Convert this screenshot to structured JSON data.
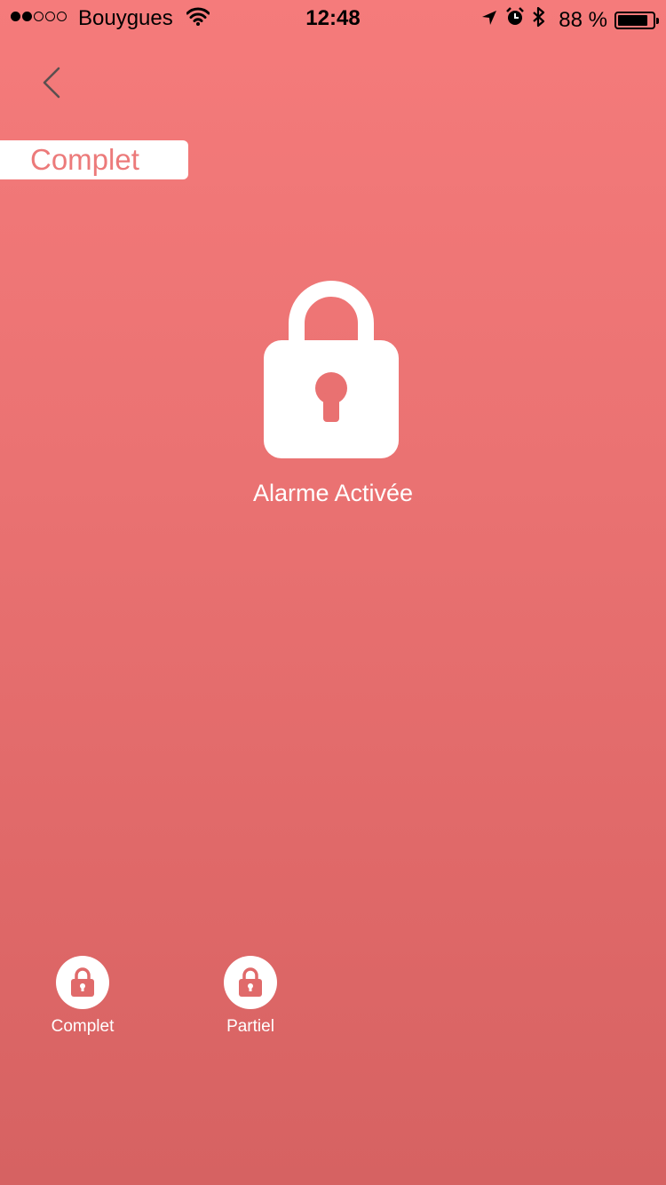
{
  "status_bar": {
    "carrier": "Bouygues",
    "signal_bars_filled": 2,
    "signal_bars_total": 5,
    "time": "12:48",
    "battery_text": "88 %",
    "battery_level": 0.88,
    "icons": [
      "wifi-icon",
      "location-arrow-icon",
      "alarm-clock-icon",
      "bluetooth-icon",
      "battery-icon"
    ]
  },
  "nav": {
    "back_icon": "chevron-left-icon"
  },
  "mode_tag": {
    "label": "Complet"
  },
  "alarm": {
    "icon": "padlock-locked-icon",
    "status_text": "Alarme Activée"
  },
  "modes": [
    {
      "label": "Complet",
      "icon": "padlock-icon"
    },
    {
      "label": "Partiel",
      "icon": "padlock-icon"
    }
  ],
  "colors": {
    "background_top": "#f57b7b",
    "background_bottom": "#d66262",
    "accent_text": "#ec7a7a",
    "foreground": "#ffffff"
  }
}
